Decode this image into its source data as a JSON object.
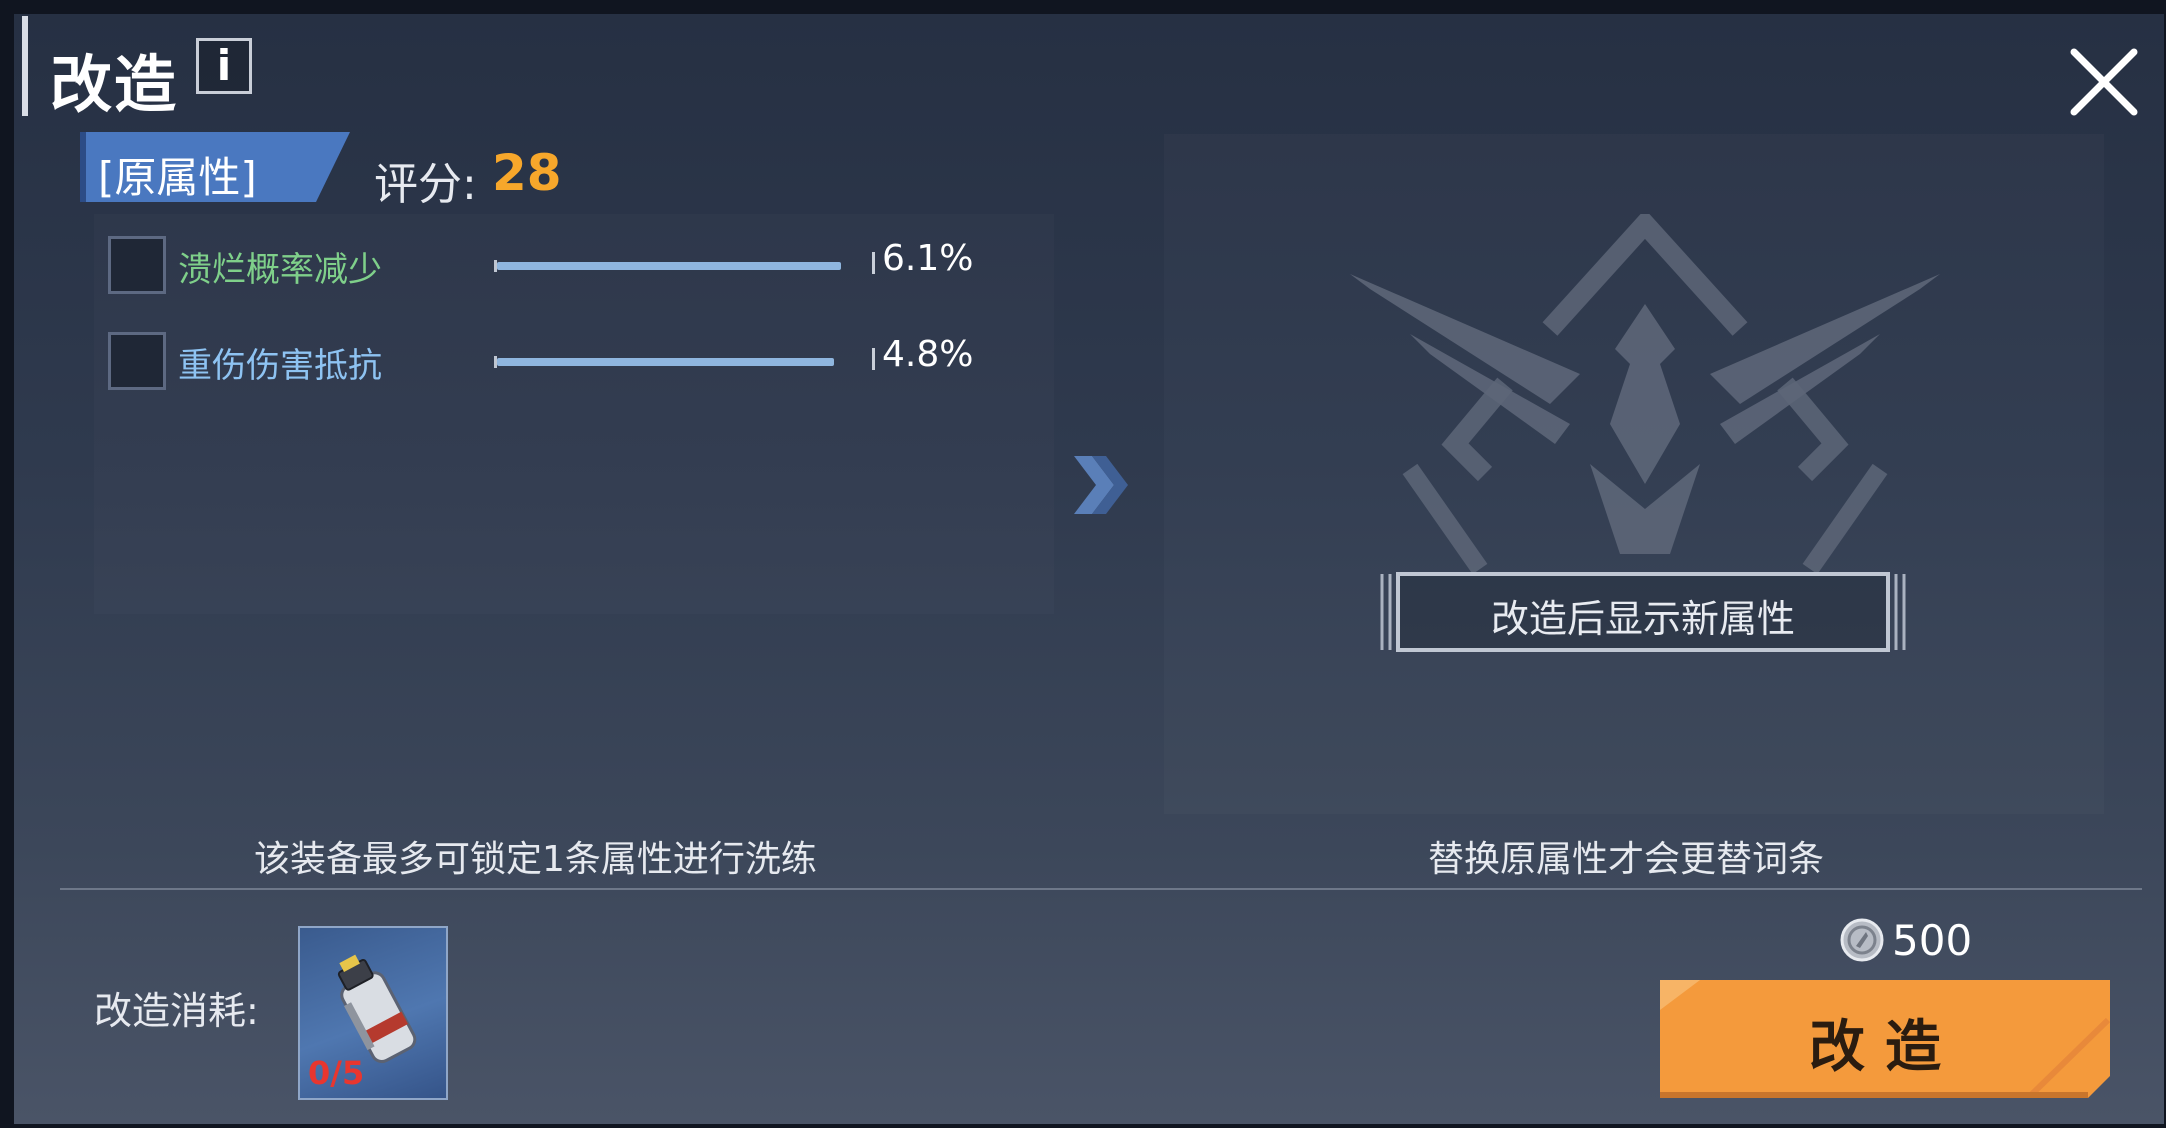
{
  "window": {
    "title": "改造",
    "info_icon": "i"
  },
  "attributes": {
    "tab_label": "[原属性]",
    "score_label": "评分:",
    "score_value": "28",
    "items": [
      {
        "label": "溃烂概率减少",
        "value": "6.1%",
        "fill_fraction": 1.0,
        "color": "#7fd08a"
      },
      {
        "label": "重伤伤害抵抗",
        "value": "4.8%",
        "fill_fraction": 0.98,
        "color": "#8ec3f2"
      }
    ]
  },
  "preview": {
    "placeholder": "改造后显示新属性"
  },
  "hints": {
    "lock_hint": "该装备最多可锁定1条属性进行洗练",
    "replace_hint": "替换原属性才会更替词条"
  },
  "cost": {
    "label": "改造消耗:",
    "item_count": "0/5",
    "coin_value": "500"
  },
  "action": {
    "button_label": "改造"
  },
  "colors": {
    "accent_orange": "#f49a3c",
    "score_orange": "#f7a72b",
    "tab_blue": "#4a78c0"
  }
}
